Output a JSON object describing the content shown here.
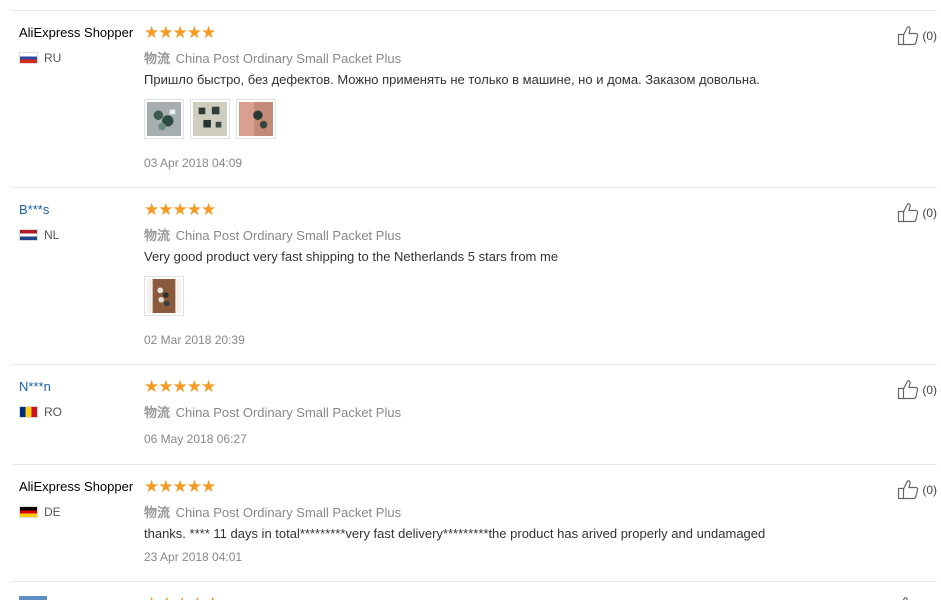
{
  "logistics_prefix": "物流",
  "reviews": [
    {
      "user": "AliExpress Shopper",
      "country": "RU",
      "stars": "★★★★★",
      "logistics": "China Post Ordinary Small Packet Plus",
      "content": "Пришло быстро, без дефектов. Можно применять не только в машине, но и дома. Заказом довольна.",
      "date": "03 Apr 2018 04:09",
      "helpful": "(0)"
    },
    {
      "user": "B***s",
      "country": "NL",
      "stars": "★★★★★",
      "logistics": "China Post Ordinary Small Packet Plus",
      "content": "Very good product very fast shipping to the Netherlands 5 stars from me",
      "date": "02 Mar 2018 20:39",
      "helpful": "(0)"
    },
    {
      "user": "N***n",
      "country": "RO",
      "stars": "★★★★★",
      "logistics": "China Post Ordinary Small Packet Plus",
      "date": "06 May 2018 06:27",
      "helpful": "(0)"
    },
    {
      "user": "AliExpress Shopper",
      "country": "DE",
      "stars": "★★★★★",
      "logistics": "China Post Ordinary Small Packet Plus",
      "content": "thanks. **** 11 days in total*********very fast delivery*********the product has arived properly and undamaged",
      "date": "23 Apr 2018 04:01",
      "helpful": "(0)"
    }
  ],
  "colors": {
    "star": "#f59a23",
    "link": "#1a5ea8",
    "date": "#888888"
  }
}
